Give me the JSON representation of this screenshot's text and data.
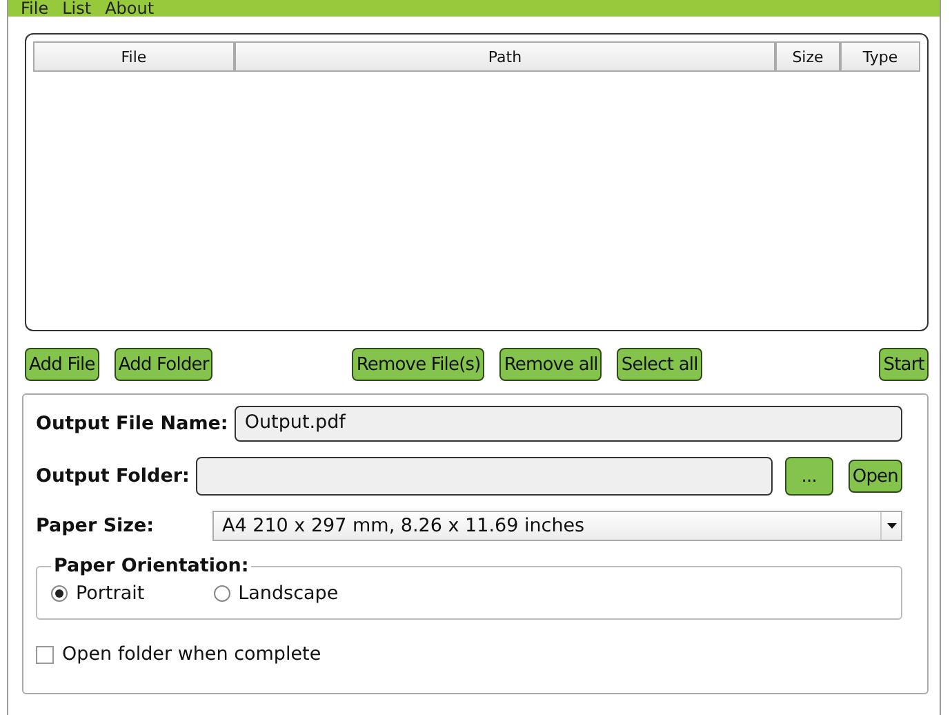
{
  "menu": [
    "File",
    "List",
    "About"
  ],
  "table": {
    "columns": [
      "File",
      "Path",
      "Size",
      "Type"
    ]
  },
  "list_buttons": {
    "left": [
      "Add File",
      "Add Folder"
    ],
    "middle": [
      "Remove File(s)",
      "Remove all",
      "Select all"
    ],
    "right": [
      "Start"
    ]
  },
  "output": {
    "name_label": "Output File Name:",
    "name_value": "Output.pdf",
    "folder_label": "Output Folder:",
    "browse": "...",
    "open": "Open",
    "paper_label": "Paper Size:",
    "paper_value": "A4 210 x 297 mm, 8.26 x 11.69 inches"
  },
  "orientation": {
    "title": "Paper Orientation:",
    "options": [
      {
        "label": "Portrait",
        "selected": true
      },
      {
        "label": "Landscape",
        "selected": false
      }
    ]
  },
  "open_when_complete": {
    "label": "Open folder when complete",
    "checked": false
  }
}
